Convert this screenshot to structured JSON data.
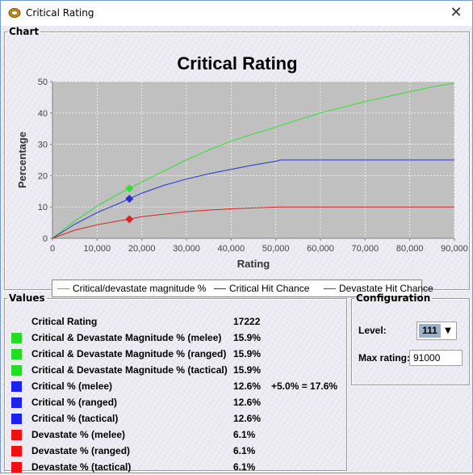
{
  "window": {
    "title": "Critical Rating",
    "close_glyph": "✕"
  },
  "icons": {
    "app": "ring-icon",
    "close": "close-icon",
    "dropdown": "chevron-down-icon"
  },
  "chart_group": {
    "legend": "Chart"
  },
  "chart_data": {
    "type": "line",
    "title": "Critical Rating",
    "xlabel": "Rating",
    "ylabel": "Percentage",
    "xlim": [
      0,
      90000
    ],
    "ylim": [
      0,
      50
    ],
    "xticks": [
      0,
      10000,
      20000,
      30000,
      40000,
      50000,
      60000,
      70000,
      80000,
      90000
    ],
    "xtick_labels": [
      "0",
      "10,000",
      "20,000",
      "30,000",
      "40,000",
      "50,000",
      "60,000",
      "70,000",
      "80,000",
      "90,000"
    ],
    "yticks": [
      0,
      10,
      20,
      30,
      40,
      50
    ],
    "ytick_labels": [
      "0",
      "10",
      "20",
      "30",
      "40",
      "50"
    ],
    "grid": true,
    "legend_position": "bottom",
    "series": [
      {
        "name": "Critical/devastate magnitude %",
        "color": "#33dd33",
        "points": [
          [
            0,
            0
          ],
          [
            5000,
            5.5
          ],
          [
            10000,
            10.3
          ],
          [
            15000,
            14.3
          ],
          [
            17222,
            15.9
          ],
          [
            20000,
            18.0
          ],
          [
            25000,
            21.5
          ],
          [
            30000,
            25.0
          ],
          [
            35000,
            28.2
          ],
          [
            40000,
            31.0
          ],
          [
            45000,
            33.3
          ],
          [
            50000,
            35.5
          ],
          [
            55000,
            37.8
          ],
          [
            60000,
            40.0
          ],
          [
            65000,
            41.8
          ],
          [
            70000,
            43.6
          ],
          [
            75000,
            45.2
          ],
          [
            80000,
            46.8
          ],
          [
            85000,
            48.3
          ],
          [
            90000,
            49.5
          ]
        ]
      },
      {
        "name": "Critical Hit Chance",
        "color": "#2233cc",
        "points": [
          [
            0,
            0
          ],
          [
            5000,
            4.5
          ],
          [
            10000,
            8.2
          ],
          [
            15000,
            11.2
          ],
          [
            17222,
            12.6
          ],
          [
            20000,
            14.4
          ],
          [
            25000,
            16.9
          ],
          [
            30000,
            18.9
          ],
          [
            35000,
            20.6
          ],
          [
            40000,
            22.0
          ],
          [
            45000,
            23.4
          ],
          [
            50000,
            24.6
          ],
          [
            51000,
            25.0
          ],
          [
            90000,
            25.0
          ]
        ]
      },
      {
        "name": "Devastate Hit Chance",
        "color": "#dd2222",
        "points": [
          [
            0,
            0
          ],
          [
            5000,
            2.6
          ],
          [
            10000,
            4.3
          ],
          [
            15000,
            5.6
          ],
          [
            17222,
            6.1
          ],
          [
            20000,
            6.9
          ],
          [
            25000,
            7.7
          ],
          [
            30000,
            8.5
          ],
          [
            35000,
            9.0
          ],
          [
            40000,
            9.4
          ],
          [
            45000,
            9.7
          ],
          [
            50000,
            9.95
          ],
          [
            51000,
            10.0
          ],
          [
            90000,
            10.0
          ]
        ]
      }
    ],
    "markers": [
      {
        "x": 17222,
        "y": 15.9,
        "color": "#33dd33"
      },
      {
        "x": 17222,
        "y": 12.6,
        "color": "#2233cc"
      },
      {
        "x": 17222,
        "y": 6.1,
        "color": "#dd2222"
      }
    ]
  },
  "values_group": {
    "legend": "Values",
    "rows": [
      {
        "swatch": "",
        "label": "Critical Rating",
        "value": "17222",
        "extra": ""
      },
      {
        "swatch": "#22dd22",
        "label": "Critical & Devastate Magnitude % (melee)",
        "value": "15.9%",
        "extra": ""
      },
      {
        "swatch": "#22dd22",
        "label": "Critical & Devastate Magnitude % (ranged)",
        "value": "15.9%",
        "extra": ""
      },
      {
        "swatch": "#22dd22",
        "label": "Critical & Devastate Magnitude % (tactical)",
        "value": "15.9%",
        "extra": ""
      },
      {
        "swatch": "#1a22ee",
        "label": "Critical % (melee)",
        "value": "12.6%",
        "extra": "+5.0% = 17.6%"
      },
      {
        "swatch": "#1a22ee",
        "label": "Critical % (ranged)",
        "value": "12.6%",
        "extra": ""
      },
      {
        "swatch": "#1a22ee",
        "label": "Critical % (tactical)",
        "value": "12.6%",
        "extra": ""
      },
      {
        "swatch": "#ee1111",
        "label": "Devastate % (melee)",
        "value": "6.1%",
        "extra": ""
      },
      {
        "swatch": "#ee1111",
        "label": "Devastate % (ranged)",
        "value": "6.1%",
        "extra": ""
      },
      {
        "swatch": "#ee1111",
        "label": "Devastate % (tactical)",
        "value": "6.1%",
        "extra": ""
      }
    ]
  },
  "config_group": {
    "legend": "Configuration",
    "level_label": "Level:",
    "level_value": "111",
    "max_rating_label": "Max rating:",
    "max_rating_value": "91000"
  }
}
